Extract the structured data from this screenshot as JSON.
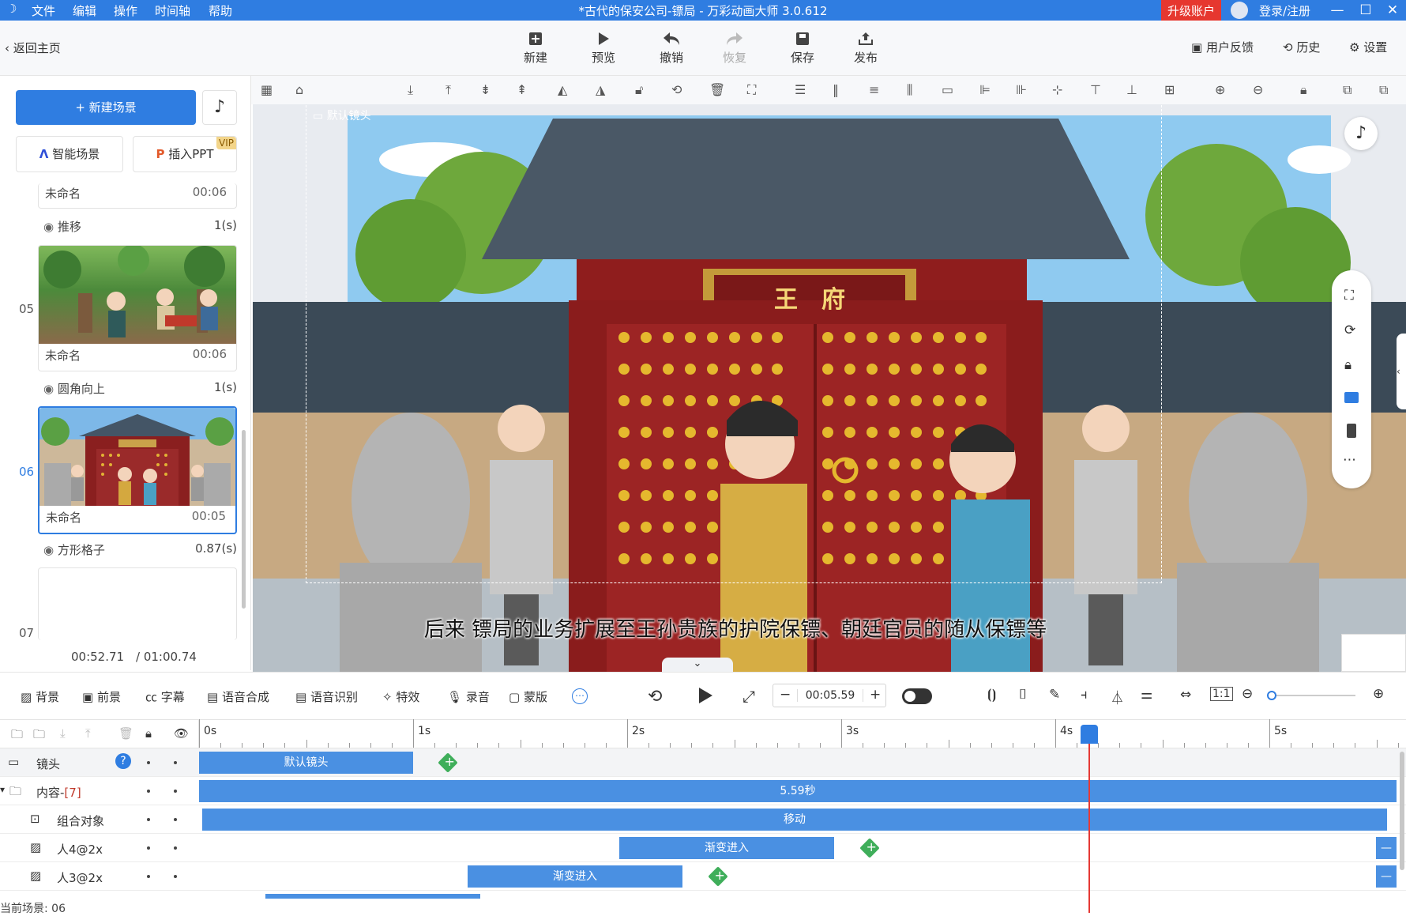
{
  "titlebar": {
    "menu": [
      "文件",
      "编辑",
      "操作",
      "时间轴",
      "帮助"
    ],
    "title": "*古代的保安公司-镖局 - 万彩动画大师 3.0.612",
    "upgrade": "升级账户",
    "login": "登录/注册"
  },
  "toolbar": {
    "back": "返回主页",
    "buttons": [
      {
        "label": "新建",
        "icon": "plus-square-icon"
      },
      {
        "label": "预览",
        "icon": "play-icon"
      },
      {
        "label": "撤销",
        "icon": "undo-icon"
      },
      {
        "label": "恢复",
        "icon": "redo-icon"
      },
      {
        "label": "保存",
        "icon": "save-icon"
      },
      {
        "label": "发布",
        "icon": "publish-icon"
      }
    ],
    "feedback": "用户反馈",
    "history": "历史",
    "settings": "设置"
  },
  "sidebar": {
    "new_scene": "+ 新建场景",
    "smart_scene": "智能场景",
    "insert_ppt": "插入PPT",
    "vip": "VIP",
    "scenes": [
      {
        "num": "",
        "name": "未命名",
        "time": "00:06",
        "transition": "推移",
        "trans_dur": "1(s)"
      },
      {
        "num": "05",
        "name": "未命名",
        "time": "00:06",
        "transition": "圆角向上",
        "trans_dur": "1(s)"
      },
      {
        "num": "06",
        "name": "未命名",
        "time": "00:05",
        "transition": "方形格子",
        "trans_dur": "0.87(s)"
      },
      {
        "num": "07",
        "name": "",
        "time": "",
        "transition": "",
        "trans_dur": ""
      }
    ],
    "current_time": "00:52.71",
    "total_time": "/ 01:00.74"
  },
  "stage": {
    "camera_label": "默认镜头",
    "sign": "王　府",
    "subtitle": "后来 镖局的业务扩展至王孙贵族的护院保镖、朝廷官员的随从保镖等"
  },
  "controls": {
    "items": [
      "背景",
      "前景",
      "字幕",
      "语音合成",
      "语音识别",
      "特效",
      "录音",
      "蒙版"
    ],
    "time_value": "00:05.59"
  },
  "timeline": {
    "ticks": [
      "0s",
      "1s",
      "2s",
      "3s",
      "4s",
      "5s"
    ],
    "rows": [
      {
        "label": "镜头",
        "bar": "默认镜头"
      },
      {
        "label": "内容-",
        "count": "[7]",
        "bar": "5.59秒"
      },
      {
        "label": "组合对象",
        "bar": "移动"
      },
      {
        "label": "人4@2x",
        "bar": "渐变进入"
      },
      {
        "label": "人3@2x",
        "bar": "渐变进入"
      }
    ],
    "current_scene": "当前场景: 06"
  },
  "colors": {
    "accent": "#2f7de1",
    "bar": "#4a90e2",
    "upgrade": "#e6372f",
    "keyframe": "#3fae5a",
    "playhead": "#e53935"
  }
}
